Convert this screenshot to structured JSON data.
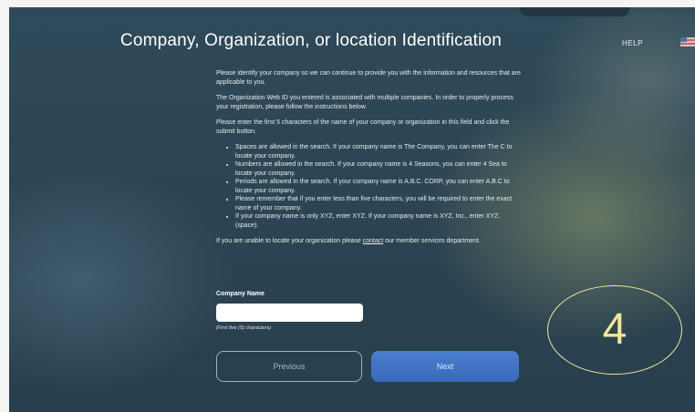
{
  "header": {
    "title": "Company, Organization, or location Identification",
    "help_label": "HELP",
    "language_flag": "us-flag-icon"
  },
  "content": {
    "para1": "Please identify your company so we can continue to provide you with the information and resources that are applicable to you.",
    "para2": "The Organization Web ID you entered is associated with multiple companies. In order to properly process your registration, please follow the instructions below.",
    "para3": "Please enter the first 5 characters of the name of your company or organization in this field and click the submit button.",
    "bullets": [
      "Spaces are allowed in the search. If your company name is The Company, you can enter The C to locate your company.",
      "Numbers are allowed in the search. If your company name is 4 Seasons, you can enter 4 Sea to locate your company.",
      "Periods are allowed in the search. If your company name is A.B.C. CORP, you can enter A.B.C to locate your company.",
      "Please remember that if you enter less than five characters, you will be required to enter the exact name of your company.",
      "If your company name is only XYZ, enter XYZ. If your company name is XYZ, Inc., enter XYZ, (space)."
    ],
    "contact_before": "If you are unable to locate your organization please ",
    "contact_link": "contact",
    "contact_after": " our member services department."
  },
  "form": {
    "company_label": "Company Name",
    "company_value": "",
    "hint": "(First five (5) characters)"
  },
  "buttons": {
    "previous": "Previous",
    "next": "Next"
  },
  "step_badge": "4",
  "colors": {
    "next_button": "#3f72c4",
    "badge": "#f2e79a"
  }
}
